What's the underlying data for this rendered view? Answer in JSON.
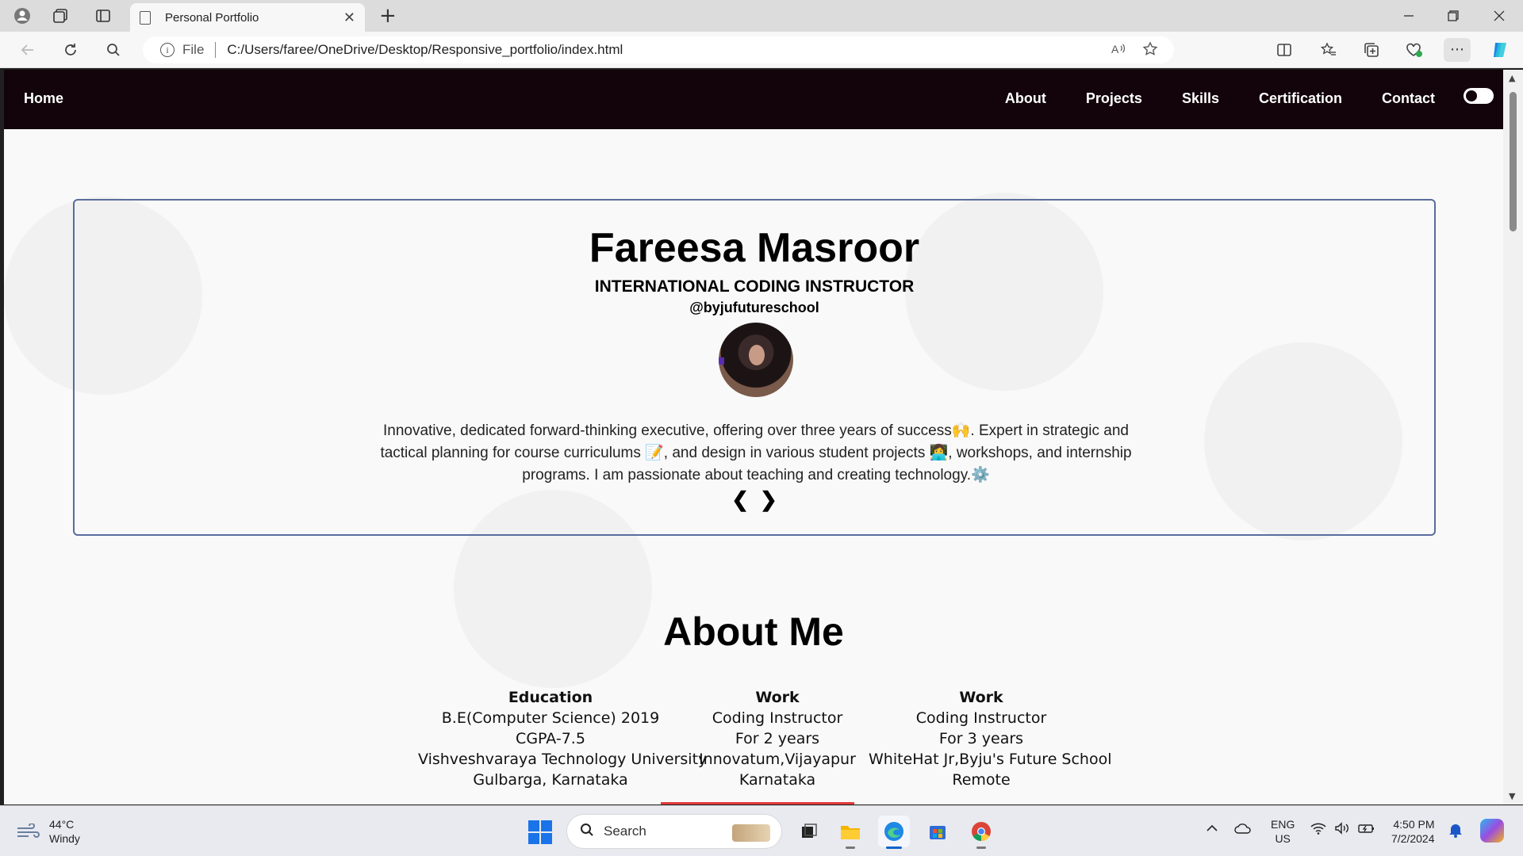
{
  "browser": {
    "tab_title": "Personal Portfolio",
    "new_tab": "+",
    "close_tab": "✕",
    "address_prefix": "File",
    "url": "C:/Users/faree/OneDrive/Desktop/Responsive_portfolio/index.html",
    "more_label": "···"
  },
  "site": {
    "nav": {
      "home": "Home",
      "links": [
        "About",
        "Projects",
        "Skills",
        "Certification",
        "Contact"
      ]
    },
    "hero": {
      "name": "Fareesa Masroor",
      "role": "INTERNATIONAL CODING INSTRUCTOR",
      "handle": "@byjufutureschool",
      "bio": "Innovative, dedicated forward-thinking executive, offering over three years of success🙌. Expert in strategic and tactical planning for course curriculums 📝, and design in various student projects 👩‍💻, workshops, and internship programs. I am passionate about teaching and creating technology.⚙️",
      "prev": "❮",
      "next": "❯"
    },
    "about": {
      "title": "About Me",
      "columns": [
        {
          "head": "Education",
          "lines": [
            "B.E(Computer Science) 2019",
            "CGPA-7.5",
            "Vishveshvaraya Technology University",
            "Gulbarga, Karnataka"
          ]
        },
        {
          "head": "Work",
          "lines": [
            "Coding Instructor",
            "For 2 years",
            "Innovatum,Vijayapur",
            "Karnataka"
          ]
        },
        {
          "head": "Work",
          "lines": [
            "Coding Instructor",
            "For 3 years",
            "WhiteHat Jr,Byju's Future School",
            "Remote"
          ]
        }
      ]
    }
  },
  "taskbar": {
    "weather_temp": "44°C",
    "weather_desc": "Windy",
    "search_placeholder": "Search",
    "lang_top": "ENG",
    "lang_bottom": "US",
    "time": "4:50 PM",
    "date": "7/2/2024"
  },
  "colors": {
    "nav_bg": "#12040a",
    "hero_border": "#5a6c9c",
    "accent_line": "#e23a3a"
  }
}
